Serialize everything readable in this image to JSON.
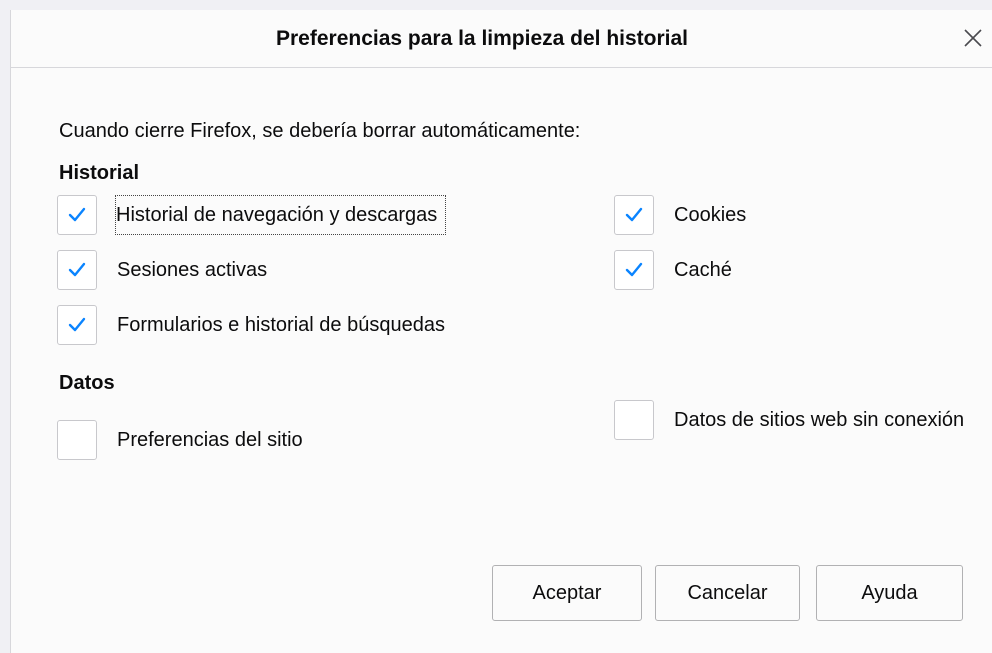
{
  "dialog": {
    "title": "Preferencias para la limpieza del historial",
    "close_glyph": "✕",
    "intro": "Cuando cierre Firefox, se debería borrar automáticamente:"
  },
  "historial": {
    "heading": "Historial",
    "items": [
      {
        "label": "Historial de navegación y descargas",
        "checked": true
      },
      {
        "label": "Cookies",
        "checked": true
      },
      {
        "label": "Sesiones activas",
        "checked": true
      },
      {
        "label": "Caché",
        "checked": true
      },
      {
        "label": "Formularios e historial de búsquedas",
        "checked": true
      }
    ]
  },
  "datos": {
    "heading": "Datos",
    "items": [
      {
        "label": "Preferencias del sitio",
        "checked": false
      },
      {
        "label": "Datos de sitios web sin conexión",
        "checked": false
      }
    ]
  },
  "buttons": {
    "accept": "Aceptar",
    "cancel": "Cancelar",
    "help": "Ayuda"
  },
  "colors": {
    "check": "#0a84ff",
    "border": "#c8c8cc"
  },
  "icons": {
    "close": "close-icon",
    "check": "checkmark-icon"
  }
}
